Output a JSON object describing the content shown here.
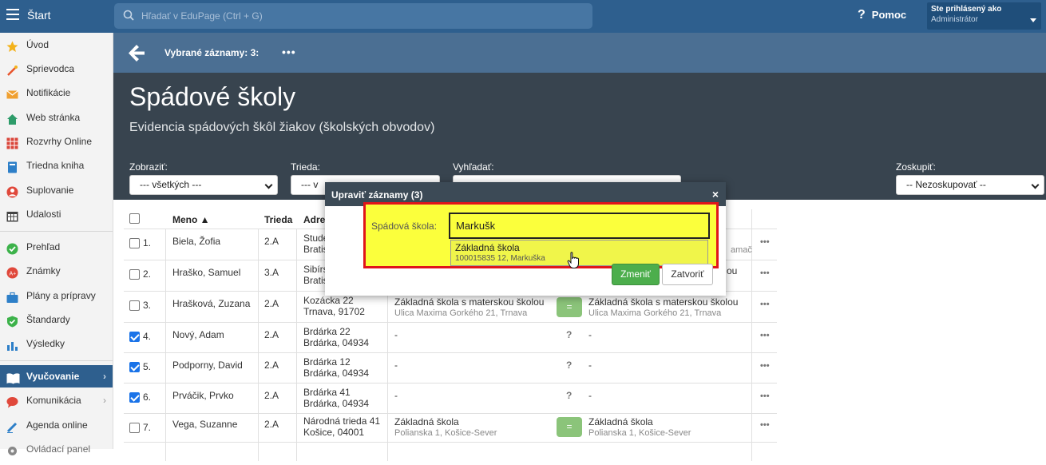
{
  "topbar": {
    "start_label": "Štart",
    "search_placeholder": "Hľadať v EduPage (Ctrl + G)",
    "help_label": "Pomoc",
    "user_line1": "Ste prihlásený ako",
    "user_line2": "Administrátor"
  },
  "sidebar": {
    "items": [
      {
        "label": "Úvod",
        "icon": "star-icon",
        "color": "#f3b21b"
      },
      {
        "label": "Sprievodca",
        "icon": "wand-icon",
        "color": "#e8542c"
      },
      {
        "label": "Notifikácie",
        "icon": "envelope-icon",
        "color": "#f0a030"
      },
      {
        "label": "Web stránka",
        "icon": "home-icon",
        "color": "#2e9c6a"
      },
      {
        "label": "Rozvrhy Online",
        "icon": "grid-icon",
        "color": "#d9453a"
      },
      {
        "label": "Triedna kniha",
        "icon": "book-icon",
        "color": "#2d7fc8"
      },
      {
        "label": "Suplovanie",
        "icon": "person-icon",
        "color": "#e0483b"
      },
      {
        "label": "Udalosti",
        "icon": "calendar-icon",
        "color": "#444444"
      },
      {
        "label": "Prehľad",
        "icon": "check-circle-icon",
        "color": "#3cb24a"
      },
      {
        "label": "Známky",
        "icon": "grades-icon",
        "color": "#e0483b"
      },
      {
        "label": "Plány a prípravy",
        "icon": "briefcase-icon",
        "color": "#2d7fc8"
      },
      {
        "label": "Štandardy",
        "icon": "shield-icon",
        "color": "#3cb24a"
      },
      {
        "label": "Výsledky",
        "icon": "bar-chart-icon",
        "color": "#2d7fc8"
      },
      {
        "label": "Vyučovanie",
        "icon": "book-open-icon",
        "color": "#ffffff"
      },
      {
        "label": "Komunikácia",
        "icon": "chat-icon",
        "color": "#e0483b"
      },
      {
        "label": "Agenda online",
        "icon": "pen-icon",
        "color": "#2d7fc8"
      },
      {
        "label": "Ovládací panel",
        "icon": "gear-icon",
        "color": "#888888"
      }
    ]
  },
  "actionbar": {
    "selected_label": "Vybrané záznamy: 3:",
    "more_label": "•••"
  },
  "header": {
    "title": "Spádové školy",
    "subtitle": "Evidencia spádových škôl žiakov (školských obvodov)"
  },
  "filters": {
    "show_label": "Zobraziť:",
    "show_value": "--- všetkých ---",
    "class_label": "Trieda:",
    "class_value": "--- v",
    "search_label": "Vyhľadať:",
    "group_label": "Zoskupiť:",
    "group_value": "-- Nezoskupovať --"
  },
  "table": {
    "headers": {
      "name": "Meno ▲",
      "class": "Trieda",
      "address": "Adres"
    },
    "rows": [
      {
        "num": "1.",
        "name": "Biela, Žofia",
        "class": "2.A",
        "addr1": "Stude",
        "addr2": "Bratis",
        "checked": false,
        "school": "",
        "school_addr": "",
        "match": "",
        "school2": "",
        "school2_addr": "amač"
      },
      {
        "num": "2.",
        "name": "Hraško, Samuel",
        "class": "3.A",
        "addr1": "Sibírs",
        "addr2": "Bratis",
        "checked": false,
        "school": "",
        "school_addr": "",
        "match": "",
        "school2": "ou",
        "school2_addr": ""
      },
      {
        "num": "3.",
        "name": "Hrašková, Zuzana",
        "class": "2.A",
        "addr1": "Kozácka 22",
        "addr2": "Trnava, 91702",
        "checked": false,
        "school": "Základná škola s materskou školou",
        "school_addr": "Ulica Maxima Gorkého 21, Trnava",
        "match": "=",
        "school2": "Základná škola s materskou školou",
        "school2_addr": "Ulica Maxima Gorkého 21, Trnava"
      },
      {
        "num": "4.",
        "name": "Nový, Adam",
        "class": "2.A",
        "addr1": "Brdárka 22",
        "addr2": "Brdárka, 04934",
        "checked": true,
        "school": "-",
        "school_addr": "",
        "match": "?",
        "school2": "-",
        "school2_addr": ""
      },
      {
        "num": "5.",
        "name": "Podporny, David",
        "class": "2.A",
        "addr1": "Brdárka 12",
        "addr2": "Brdárka, 04934",
        "checked": true,
        "school": "-",
        "school_addr": "",
        "match": "?",
        "school2": "-",
        "school2_addr": ""
      },
      {
        "num": "6.",
        "name": "Prváčik, Prvko",
        "class": "2.A",
        "addr1": "Brdárka 41",
        "addr2": "Brdárka, 04934",
        "checked": true,
        "school": "-",
        "school_addr": "",
        "match": "?",
        "school2": "-",
        "school2_addr": ""
      },
      {
        "num": "7.",
        "name": "Vega, Suzanne",
        "class": "2.A",
        "addr1": "Národná trieda 41",
        "addr2": "Košice, 04001",
        "checked": false,
        "school": "Základná škola",
        "school_addr": "Polianska 1, Košice-Sever",
        "match": "=",
        "school2": "Základná škola",
        "school2_addr": "Polianska 1, Košice-Sever"
      }
    ],
    "row_menu": "•••"
  },
  "modal": {
    "title": "Upraviť záznamy (3)",
    "close": "×",
    "field_label": "Spádová škola:",
    "field_value": "Markušk",
    "suggestion_title": "Základná škola",
    "suggestion_sub": "100015835 12, Markuška",
    "ok_label": "Zmeniť",
    "cancel_label": "Zatvoriť"
  }
}
